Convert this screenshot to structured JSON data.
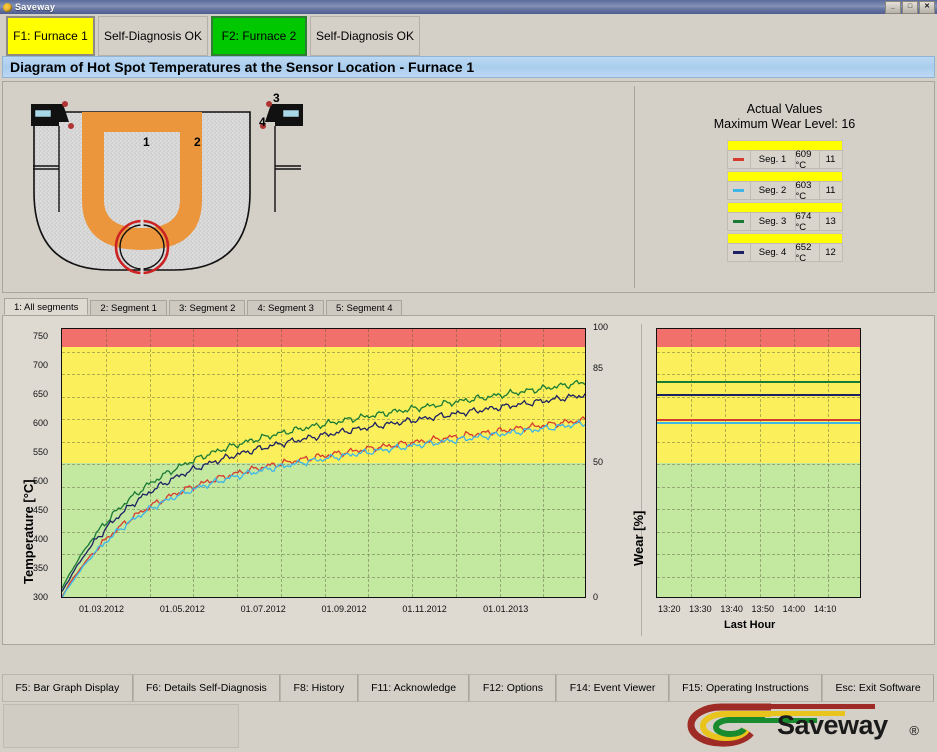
{
  "window": {
    "title": "Saveway",
    "app_icon": "saveway-logo-icon",
    "buttons": {
      "minimize": "_",
      "maximize": "□",
      "close": "✕"
    }
  },
  "furnace_bar": {
    "items": [
      {
        "name": "furnace-1",
        "label": "F1: Furnace 1",
        "color": "#ffff00",
        "selected": true
      },
      {
        "name": "furnace-1-status",
        "label": "Self-Diagnosis OK",
        "color": "#d4d0c8",
        "selected": false
      },
      {
        "name": "furnace-2",
        "label": "F2: Furnace 2",
        "color": "#00c800",
        "selected": false
      },
      {
        "name": "furnace-2-status",
        "label": "Self-Diagnosis OK",
        "color": "#d4d0c8",
        "selected": false
      }
    ]
  },
  "heading": {
    "text": "Diagram of Hot Spot Temperatures at the Sensor Location - Furnace 1"
  },
  "diagram": {
    "sensor_labels": [
      "1",
      "2",
      "3",
      "4"
    ],
    "colors": {
      "refractory": "#d9d9d9",
      "hot_zone": "#eb963c",
      "outline": "#111111",
      "sensor_marker": "#b03434",
      "wear_ring": "#cc2222"
    }
  },
  "actual_values": {
    "title_line1": "Actual Values",
    "title_line2": "Maximum Wear Level: 16",
    "rows": [
      {
        "name": "segment-1",
        "swatch": "#d63b2f",
        "label": "Seg. 1",
        "temperature": "609 °C",
        "wear": "11"
      },
      {
        "name": "segment-2",
        "swatch": "#3fb6e8",
        "label": "Seg. 2",
        "temperature": "603 °C",
        "wear": "11"
      },
      {
        "name": "segment-3",
        "swatch": "#1a7a35",
        "label": "Seg. 3",
        "temperature": "674 °C",
        "wear": "13"
      },
      {
        "name": "segment-4",
        "swatch": "#1c2163",
        "label": "Seg. 4",
        "temperature": "652 °C",
        "wear": "12"
      }
    ],
    "bar_color": "#ffff00"
  },
  "tabs": [
    {
      "name": "tab-all-segments",
      "label": "1: All segments",
      "active": true
    },
    {
      "name": "tab-segment-1",
      "label": "2: Segment 1",
      "active": false
    },
    {
      "name": "tab-segment-2",
      "label": "3: Segment 2",
      "active": false
    },
    {
      "name": "tab-segment-3",
      "label": "4: Segment 3",
      "active": false
    },
    {
      "name": "tab-segment-4",
      "label": "5: Segment 4",
      "active": false
    }
  ],
  "chart_data": [
    {
      "id": "main-trend-chart",
      "type": "line",
      "title": "",
      "xlabel": "",
      "ylabel": "Temperature [°C]",
      "y2label": "Wear [%]",
      "ylim": [
        300,
        765
      ],
      "yticks": [
        300,
        350,
        400,
        450,
        500,
        550,
        600,
        650,
        700,
        750
      ],
      "y2lim": [
        0,
        100
      ],
      "y2ticks": [
        0,
        50,
        85,
        100
      ],
      "xticklabels": [
        "01.03.2012",
        "01.05.2012",
        "01.07.2012",
        "01.09.2012",
        "01.11.2012",
        "01.01.2013"
      ],
      "grid": true,
      "legend_position": "none",
      "bands": [
        {
          "name": "green-zone",
          "from": 300,
          "to": 530,
          "color": "#c3e8a0"
        },
        {
          "name": "yellow-zone",
          "from": 530,
          "to": 730,
          "color": "#fbf05c"
        },
        {
          "name": "red-zone",
          "from": 730,
          "to": 765,
          "color": "#f2706b"
        }
      ],
      "series": [
        {
          "name": "Seg. 3",
          "color": "#1a7a35",
          "start": 318,
          "end": 674
        },
        {
          "name": "Seg. 4",
          "color": "#1c2163",
          "start": 312,
          "end": 652
        },
        {
          "name": "Seg. 1",
          "color": "#d63b2f",
          "start": 305,
          "end": 609
        },
        {
          "name": "Seg. 2",
          "color": "#3fb6e8",
          "start": 302,
          "end": 603
        }
      ]
    },
    {
      "id": "last-hour-chart",
      "type": "line",
      "title": "",
      "xlabel": "Last Hour",
      "ylabel": "",
      "ylim": [
        300,
        765
      ],
      "xticklabels": [
        "13:20",
        "13:30",
        "13:40",
        "13:50",
        "14:00",
        "14:10"
      ],
      "grid": true,
      "legend_position": "none",
      "bands": [
        {
          "name": "green-zone",
          "from": 300,
          "to": 530,
          "color": "#c3e8a0"
        },
        {
          "name": "yellow-zone",
          "from": 530,
          "to": 730,
          "color": "#fbf05c"
        },
        {
          "name": "red-zone",
          "from": 730,
          "to": 765,
          "color": "#f2706b"
        }
      ],
      "series": [
        {
          "name": "Seg. 3",
          "color": "#1a7a35",
          "value": 674
        },
        {
          "name": "Seg. 4",
          "color": "#1c2163",
          "value": 652
        },
        {
          "name": "Seg. 1",
          "color": "#d63b2f",
          "value": 609
        },
        {
          "name": "Seg. 2",
          "color": "#3fb6e8",
          "value": 603
        }
      ]
    }
  ],
  "function_keys": [
    {
      "name": "fkey-bar-graph-display",
      "label": "F5: Bar Graph Display"
    },
    {
      "name": "fkey-details-self-diagnosis",
      "label": "F6: Details Self-Diagnosis"
    },
    {
      "name": "fkey-history",
      "label": "F8: History"
    },
    {
      "name": "fkey-acknowledge",
      "label": "F11: Acknowledge"
    },
    {
      "name": "fkey-options",
      "label": "F12: Options"
    },
    {
      "name": "fkey-event-viewer",
      "label": "F14: Event Viewer"
    },
    {
      "name": "fkey-operating-instructions",
      "label": "F15: Operating Instructions"
    },
    {
      "name": "fkey-exit-software",
      "label": "Esc: Exit Software"
    }
  ],
  "brand": {
    "name": "Saveway",
    "registered": "®"
  }
}
